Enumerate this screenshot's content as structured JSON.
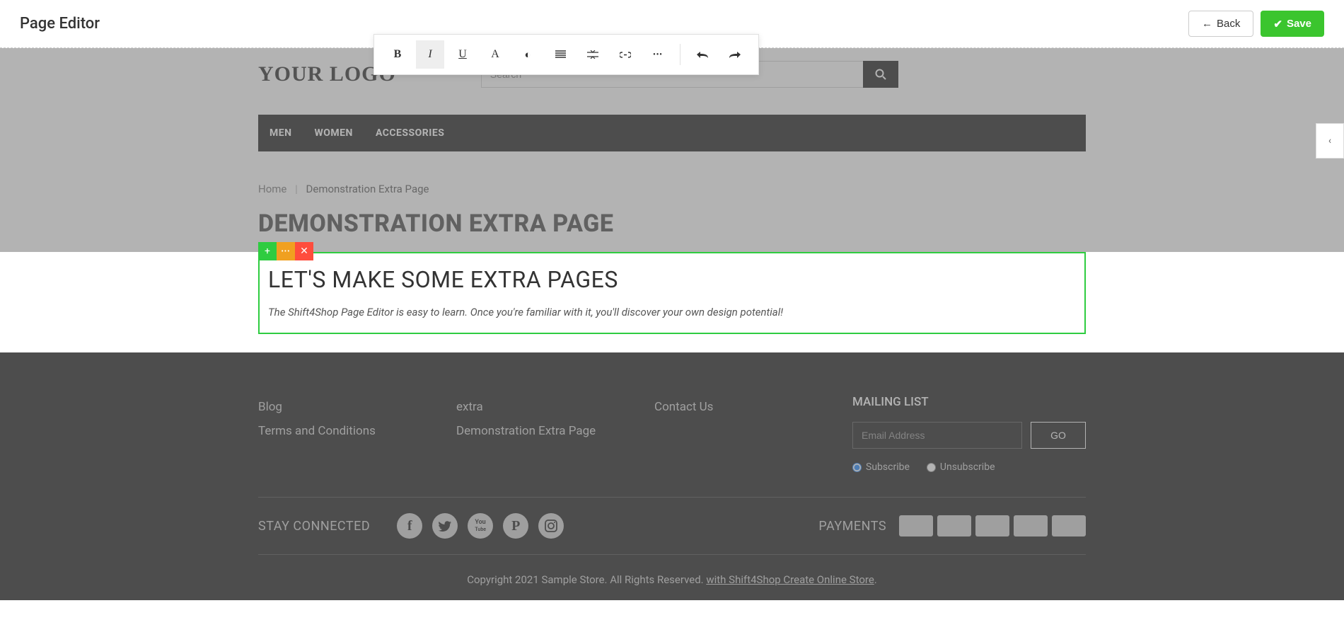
{
  "editor": {
    "title": "Page Editor",
    "back_label": "Back",
    "save_label": "Save"
  },
  "toolbar": {
    "bold": "B",
    "italic": "I",
    "underline": "U",
    "font": "A",
    "contrast": "◐",
    "align": "≣",
    "spacing": "⇆",
    "link": "🔗",
    "more": "•••",
    "undo": "↶",
    "redo": "↷"
  },
  "store": {
    "logo": "YOUR LOGO",
    "search_placeholder": "Search",
    "nav": [
      "MEN",
      "WOMEN",
      "ACCESSORIES"
    ],
    "breadcrumb": {
      "home": "Home",
      "current": "Demonstration Extra Page"
    },
    "page_title": "DEMONSTRATION EXTRA PAGE"
  },
  "content": {
    "heading": "LET'S MAKE SOME EXTRA PAGES",
    "paragraph": "The Shift4Shop Page Editor is easy to learn. Once you're familiar with it, you'll discover your own design potential!"
  },
  "footer": {
    "cols": [
      [
        "Blog",
        "Terms and Conditions"
      ],
      [
        "extra",
        "Demonstration Extra Page"
      ],
      [
        "Contact Us"
      ]
    ],
    "mailing": {
      "title": "MAILING LIST",
      "email_placeholder": "Email Address",
      "go_label": "GO",
      "subscribe": "Subscribe",
      "unsubscribe": "Unsubscribe"
    },
    "stay_connected": "STAY CONNECTED",
    "payments_label": "PAYMENTS",
    "copyright": "Copyright 2021 Sample Store. All Rights Reserved. ",
    "credit_link": "with Shift4Shop Create Online Store",
    "credit_tail": "."
  }
}
